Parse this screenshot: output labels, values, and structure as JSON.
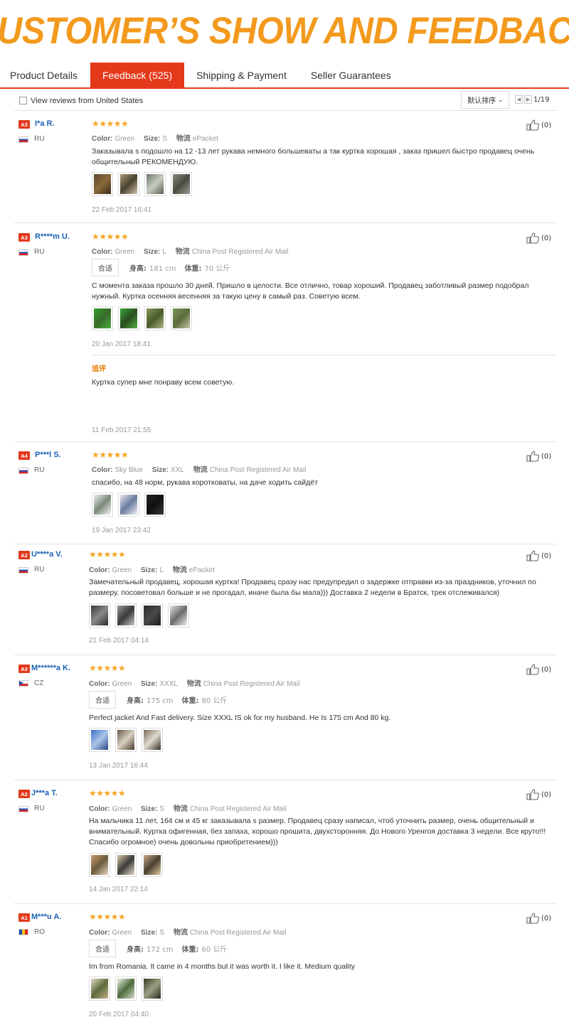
{
  "banner": {
    "title": "CUSTOMER’S SHOW AND FEEDBACK"
  },
  "tabs": [
    {
      "label": "Product Details"
    },
    {
      "label": "Feedback (525)"
    },
    {
      "label": "Shipping & Payment"
    },
    {
      "label": "Seller Guarantees"
    }
  ],
  "filter": {
    "checkbox_label": "View reviews from United States",
    "sort_label": "默认排序",
    "page": "1/19"
  },
  "labels": {
    "color": "Color:",
    "size": "Size:",
    "logistics": "物流",
    "fit": "合适",
    "height": "身高:",
    "weight": "体重:",
    "additional": "追评"
  },
  "colors": {
    "accent": "#e5391b",
    "banner": "#f39a1e",
    "link": "#1a5fb4",
    "star": "#f5a623"
  },
  "reviews": [
    {
      "level": "A3",
      "name": "I*a R.",
      "country": "RU",
      "stars": "★★★★★",
      "color": "Green",
      "size": "S",
      "logistics": "ePacket",
      "text": "Заказывала s подошло на 12 -13 лет рукава немного большеваты а так куртка хорошая , заказ пришел быстро продавец очень общительный РЕКОМЕНДУЮ.",
      "date": "22 Feb 2017 16:41",
      "likes": "(0)"
    },
    {
      "level": "A3",
      "name": "R****m U.",
      "country": "RU",
      "stars": "★★★★★",
      "color": "Green",
      "size": "L",
      "logistics": "China Post Registered Air Mail",
      "fit": {
        "height": "181 cm",
        "weight": "70 公斤"
      },
      "text": "С момента заказа прошло 30 дней. Пришло в целости. Все отлично, товар хороший. Продавец заботливый размер подобрал нужный. Куртка осенняя весенняя за такую цену в самый раз. Советую всем.",
      "date": "20 Jan 2017 18:41",
      "likes": "(0)",
      "additional": {
        "text": "Куртка супер мне понраву всем советую.",
        "date": "11 Feb 2017 21:55"
      }
    },
    {
      "level": "A4",
      "name": "P***l S.",
      "country": "RU",
      "stars": "★★★★★",
      "color": "Sky Blue",
      "size": "XXL",
      "logistics": "China Post Registered Air Mail",
      "text": "спасибо, на 48 норм, рукава коротковаты, на даче ходить сайдёт",
      "date": "19 Jan 2017 23:42",
      "likes": "(0)"
    },
    {
      "level": "A2",
      "name": "U****a V.",
      "country": "RU",
      "stars": "★★★★★",
      "color": "Green",
      "size": "L",
      "logistics": "ePacket",
      "text": "Замечательный продавец, хорошая куртка! Продавец сразу нас предупредил о задержке отправки из-за праздников, уточнил по размеру, посоветовал больше и не прогадал, иначе была бы мала))) Доставка 2 недели в Братск, трек отслеживался)",
      "date": "21 Feb 2017 04:14",
      "likes": "(0)"
    },
    {
      "level": "A3",
      "name": "M******a K.",
      "country": "CZ",
      "stars": "★★★★★",
      "color": "Green",
      "size": "XXXL",
      "logistics": "China Post Registered Air Mail",
      "fit": {
        "height": "175 cm",
        "weight": "80 公斤"
      },
      "text": "Perfect jacket And Fast delivery. Size XXXL IS ok for my husband. He Is 175 cm And 80 kg.",
      "date": "13 Jan 2017 16:44",
      "likes": "(0)"
    },
    {
      "level": "A2",
      "name": "J***a T.",
      "country": "RU",
      "stars": "★★★★★",
      "color": "Green",
      "size": "S",
      "logistics": "China Post Registered Air Mail",
      "text": "На мальчика 11 лет, 164 см и 45 кг заказывала s размер. Продавец сразу написал, чтоб уточнить размер, очень общительный и внимательный. Куртка офигенная, без запаха, хорошо прошита, двухсторонняя. До Нового Уренгоя доставка 3 недели. Все круто!!! Спасибо огромное) очень довольны приобретением)))",
      "date": "14 Jan 2017 22:14",
      "likes": "(0)"
    },
    {
      "level": "A1",
      "name": "M***u A.",
      "country": "RO",
      "stars": "★★★★★",
      "color": "Green",
      "size": "S",
      "logistics": "China Post Registered Air Mail",
      "fit": {
        "height": "172 cm",
        "weight": "60 公斤"
      },
      "text": "Im from Romania. It came in 4 months but it was worth it. I like it. Medium quality",
      "date": "20 Feb 2017 04:40",
      "likes": "(0)"
    }
  ]
}
